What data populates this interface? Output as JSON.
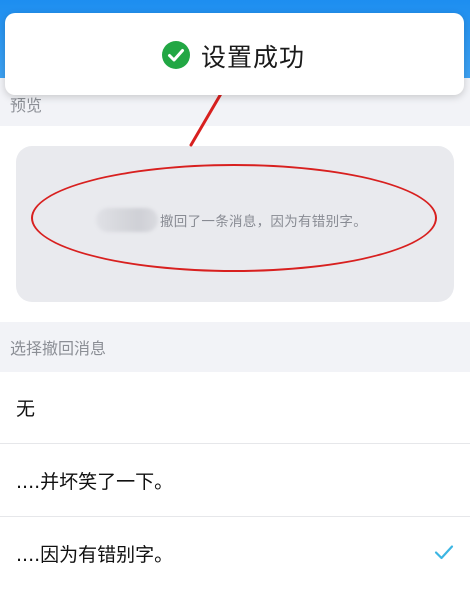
{
  "toast": {
    "text": "设置成功",
    "success_color": "#22a744"
  },
  "preview": {
    "section_label": "预览",
    "recall_message": "撤回了一条消息，因为有错别字。"
  },
  "choose": {
    "section_label": "选择撤回消息",
    "options": [
      {
        "label": "无",
        "selected": false
      },
      {
        "label": "....并坏笑了一下。",
        "selected": false
      },
      {
        "label": "....因为有错别字。",
        "selected": true
      }
    ]
  },
  "colors": {
    "top_bar": "#1d8ef0",
    "annotation_red": "#d8201f",
    "check_accent": "#3cb6e3"
  }
}
